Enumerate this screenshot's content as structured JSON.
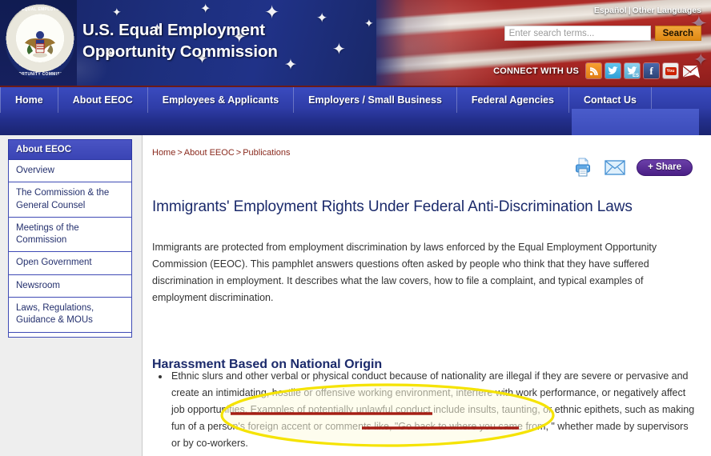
{
  "header": {
    "org_name_line1": "U.S. Equal Employment",
    "org_name_line2": "Opportunity Commission",
    "seal_text_top": "U.S. EQUAL EMPLOYMENT",
    "seal_text_bottom": "OPPORTUNITY COMMISSION",
    "lang_primary": "Español",
    "lang_separator": "|",
    "lang_secondary": "Other Languages",
    "connect_label": "CONNECT WITH US",
    "social_icons": [
      {
        "name": "rss-icon",
        "glyph": "◠"
      },
      {
        "name": "twitter-icon",
        "glyph": "ᴠ"
      },
      {
        "name": "twitter-spanish-icon",
        "glyph": "ᴠ",
        "badge": "ES"
      },
      {
        "name": "facebook-icon",
        "glyph": "f"
      },
      {
        "name": "youtube-icon",
        "glyph": "You"
      },
      {
        "name": "email-icon",
        "glyph": "✉"
      }
    ]
  },
  "search": {
    "placeholder": "Enter search terms...",
    "value": "",
    "button_label": "Search"
  },
  "nav": {
    "items": [
      {
        "label": "Home"
      },
      {
        "label": "About EEOC"
      },
      {
        "label": "Employees & Applicants"
      },
      {
        "label": "Employers / Small Business"
      },
      {
        "label": "Federal Agencies"
      },
      {
        "label": "Contact Us"
      }
    ]
  },
  "sidebar": {
    "header": "About EEOC",
    "items": [
      {
        "label": "Overview"
      },
      {
        "label": "The Commission & the General Counsel"
      },
      {
        "label": "Meetings of the Commission"
      },
      {
        "label": "Open Government"
      },
      {
        "label": "Newsroom"
      },
      {
        "label": "Laws, Regulations, Guidance & MOUs"
      }
    ]
  },
  "content": {
    "breadcrumb": [
      "Home",
      "About EEOC",
      "Publications"
    ],
    "breadcrumb_separator": ">",
    "actions": {
      "print_label": "Print",
      "email_label": "Email",
      "share_label": "+ Share"
    },
    "page_title": "Immigrants' Employment Rights Under Federal Anti-Discrimination Laws",
    "intro_paragraph": "Immigrants are protected from employment discrimination by laws enforced by the Equal Employment Opportunity Commission (EEOC). This pamphlet answers questions often asked by people who think that they have suffered discrimination in employment. It describes what the law covers, how to file a complaint, and typical examples of employment discrimination.",
    "section_heading": "Harassment Based on National Origin",
    "bullet_1": "Ethnic slurs and other verbal or physical conduct because of nationality are illegal if they are severe or pervasive and create an intimidating, hostile or offensive working environment, interfere with work performance, or negatively affect job opportunities. Examples of potentially unlawful conduct include insults, taunting, or ethnic epithets, such as making fun of a person's foreign accent or comments like, \"Go back to where you came from, \" whether made by supervisors or by co-workers."
  },
  "annotations": {
    "ellipse_color": "#f5e300",
    "ellipse_fill": "#fdfbe0",
    "underline_color": "#a51f15",
    "underline_1_text": "Examples of potentially unlawful conduct include",
    "underline_2_text": "\"Go back to where you came from, \""
  },
  "colors": {
    "header_blue": "#1b2a6b",
    "nav_blue": "#2f3da8",
    "accent_orange": "#e08a14",
    "breadcrumb_red": "#8a2a1e",
    "link_blue": "#24306e",
    "share_purple": "#4a1f86"
  }
}
